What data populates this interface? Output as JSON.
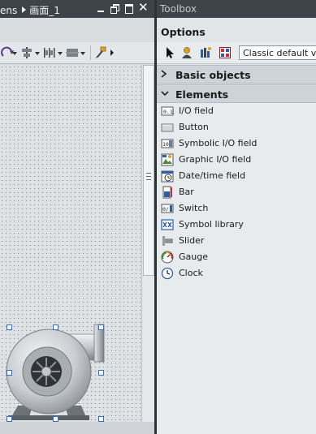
{
  "editor": {
    "title_parts": [
      "ens",
      "画面_1"
    ],
    "close_glyph": "✕",
    "scroll_grip_glyph": "≡"
  },
  "toolbox": {
    "title": "Toolbox",
    "options_label": "Options",
    "style_select_value": "Classic default v",
    "sections": [
      {
        "label": "Basic objects",
        "expanded": false
      },
      {
        "label": "Elements",
        "expanded": true
      }
    ],
    "elements": [
      {
        "label": "I/O field",
        "icon": "io-field-icon"
      },
      {
        "label": "Button",
        "icon": "button-icon"
      },
      {
        "label": "Symbolic I/O field",
        "icon": "symbolic-io-field-icon"
      },
      {
        "label": "Graphic I/O field",
        "icon": "graphic-io-field-icon"
      },
      {
        "label": "Date/time field",
        "icon": "date-time-field-icon"
      },
      {
        "label": "Bar",
        "icon": "bar-icon"
      },
      {
        "label": "Switch",
        "icon": "switch-icon"
      },
      {
        "label": "Symbol library",
        "icon": "symbol-library-icon"
      },
      {
        "label": "Slider",
        "icon": "slider-icon"
      },
      {
        "label": "Gauge",
        "icon": "gauge-icon"
      },
      {
        "label": "Clock",
        "icon": "clock-icon"
      }
    ]
  },
  "colors": {
    "title_bar": "#3e4349",
    "selection_handle": "#2a6fd8",
    "section_bg": "#cdd3d8"
  }
}
